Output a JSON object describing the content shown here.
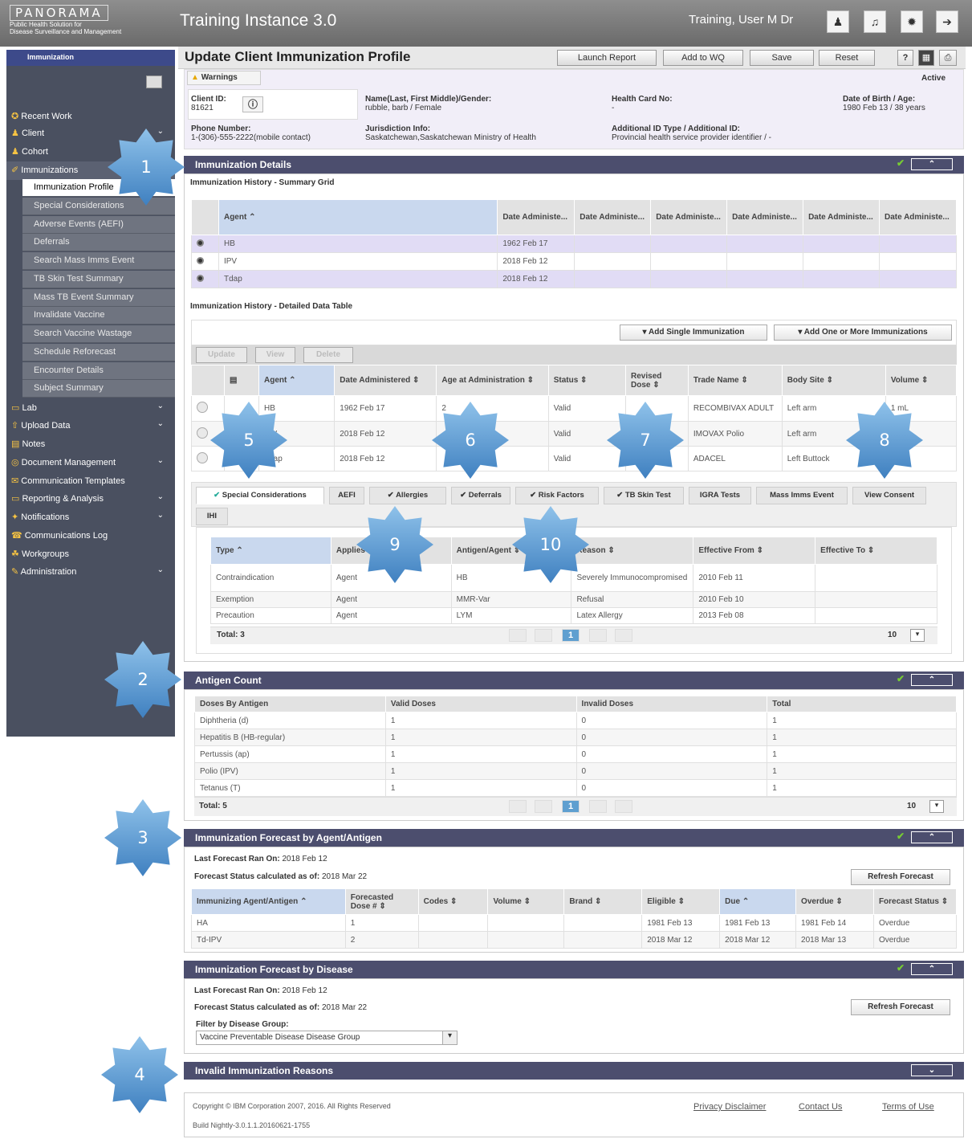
{
  "brand": {
    "name": "PANORAMA",
    "tagline1": "Public Health Solution for",
    "tagline2": "Disease Surveillance and Management"
  },
  "instance": "Training Instance 3.0",
  "user": "Training, User M Dr",
  "sidebar": {
    "header": "Immunization",
    "items": [
      {
        "label": "Recent Work",
        "icon": "✪"
      },
      {
        "label": "Client",
        "icon": "♟"
      },
      {
        "label": "Cohort",
        "icon": "♟"
      },
      {
        "label": "Immunizations",
        "icon": "✐"
      }
    ],
    "subitems": [
      "Immunization Profile",
      "Special Considerations",
      "Adverse Events (AEFI)",
      "Deferrals",
      "Search Mass Imms Event",
      "TB Skin Test Summary",
      "Mass TB Event Summary",
      "Invalidate Vaccine",
      "Search Vaccine Wastage",
      "Schedule Reforecast",
      "Encounter Details",
      "Subject Summary"
    ],
    "lower": [
      {
        "label": "Lab",
        "icon": "▭"
      },
      {
        "label": "Upload Data",
        "icon": "⇧"
      },
      {
        "label": "Notes",
        "icon": "▤"
      },
      {
        "label": "Document Management",
        "icon": "◎"
      },
      {
        "label": "Communication Templates",
        "icon": "✉"
      },
      {
        "label": "Reporting & Analysis",
        "icon": "▭"
      },
      {
        "label": "Notifications",
        "icon": "✦"
      },
      {
        "label": "Communications Log",
        "icon": "☎"
      },
      {
        "label": "Workgroups",
        "icon": "☘"
      },
      {
        "label": "Administration",
        "icon": "✎"
      }
    ]
  },
  "page": {
    "title": "Update Client Immunization Profile",
    "buttons": {
      "launch": "Launch Report",
      "wq": "Add to WQ",
      "save": "Save",
      "reset": "Reset"
    }
  },
  "client": {
    "warnings": "Warnings",
    "status": "Active",
    "id_label": "Client ID:",
    "id": "81621",
    "name_label": "Name(Last, First Middle)/Gender:",
    "name": "rubble, barb / Female",
    "hc_label": "Health Card No:",
    "hc": "-",
    "dob_label": "Date of Birth / Age:",
    "dob": "1980 Feb 13 / 38 years",
    "phone_label": "Phone Number:",
    "phone": "1-(306)-555-2222(mobile contact)",
    "juris_label": "Jurisdiction Info:",
    "juris": "Saskatchewan,Saskatchewan Ministry of Health",
    "addl_label": "Additional ID Type / Additional ID:",
    "addl": "Provincial health service provider identifier / -"
  },
  "imm": {
    "title": "Immunization Details",
    "summary_title": "Immunization History - Summary Grid",
    "summary_headers": [
      "Agent",
      "Date Administe...",
      "Date Administe...",
      "Date Administe...",
      "Date Administe...",
      "Date Administe...",
      "Date Administe..."
    ],
    "summary_rows": [
      [
        "HB",
        "1962 Feb 17"
      ],
      [
        "IPV",
        "2018 Feb 12"
      ],
      [
        "Tdap",
        "2018 Feb 12"
      ]
    ],
    "detail_title": "Immunization History - Detailed Data Table",
    "add_single": "Add Single Immunization",
    "add_more": "Add One or More Immunizations",
    "actions": [
      "Update",
      "View",
      "Delete"
    ],
    "detail_headers": [
      "Agent",
      "Date Administered",
      "Age at Administration",
      "Status",
      "Revised Dose",
      "Trade Name",
      "Body Site",
      "Volume"
    ],
    "detail_rows": [
      [
        "HB",
        "1962 Feb 17",
        "2",
        "Valid",
        "",
        "RECOMBIVAX ADULT",
        "Left arm",
        "1 mL"
      ],
      [
        "IPV",
        "2018 Feb 12",
        "",
        "Valid",
        "",
        "IMOVAX Polio",
        "Left arm",
        ""
      ],
      [
        "Tdap",
        "2018 Feb 12",
        "",
        "Valid",
        "",
        "ADACEL",
        "Left Buttock",
        ""
      ]
    ],
    "tabs": [
      "Special Considerations",
      "AEFI",
      "Allergies",
      "Deferrals",
      "Risk Factors",
      "TB Skin Test",
      "IGRA Tests",
      "Mass Imms Event",
      "View Consent",
      "IHI"
    ],
    "sc_headers": [
      "Type",
      "Applies To",
      "Antigen/Agent",
      "Reason",
      "Effective From",
      "Effective To"
    ],
    "sc_rows": [
      [
        "Contraindication",
        "Agent",
        "HB",
        "Severely Immunocompromised",
        "2010 Feb 11",
        ""
      ],
      [
        "Exemption",
        "Agent",
        "MMR-Var",
        "Refusal",
        "2010 Feb 10",
        ""
      ],
      [
        "Precaution",
        "Agent",
        "LYM",
        "Latex Allergy",
        "2013 Feb 08",
        ""
      ]
    ],
    "sc_total": "Total: 3",
    "page": "1",
    "pagesize": "10"
  },
  "antigen": {
    "title": "Antigen Count",
    "headers": [
      "Doses By Antigen",
      "Valid Doses",
      "Invalid Doses",
      "Total"
    ],
    "rows": [
      [
        "Diphtheria (d)",
        "1",
        "0",
        "1"
      ],
      [
        "Hepatitis B (HB-regular)",
        "1",
        "0",
        "1"
      ],
      [
        "Pertussis (ap)",
        "1",
        "0",
        "1"
      ],
      [
        "Polio (IPV)",
        "1",
        "0",
        "1"
      ],
      [
        "Tetanus (T)",
        "1",
        "0",
        "1"
      ]
    ],
    "total": "Total: 5",
    "page": "1",
    "pagesize": "10"
  },
  "forecast": {
    "title": "Immunization Forecast by Agent/Antigen",
    "ran_label": "Last Forecast Ran On:",
    "ran": "2018 Feb 12",
    "calc_label": "Forecast Status calculated as of:",
    "calc": "2018 Mar 22",
    "refresh": "Refresh Forecast",
    "headers": [
      "Immunizing Agent/Antigen",
      "Forecasted Dose #",
      "Codes",
      "Volume",
      "Brand",
      "Eligible",
      "Due",
      "Overdue",
      "Forecast Status"
    ],
    "rows": [
      [
        "HA",
        "1",
        "",
        "",
        "",
        "1981 Feb 13",
        "1981 Feb 13",
        "1981 Feb 14",
        "Overdue"
      ],
      [
        "Td-IPV",
        "2",
        "",
        "",
        "",
        "2018 Mar 12",
        "2018 Mar 12",
        "2018 Mar 13",
        "Overdue"
      ]
    ]
  },
  "disease": {
    "title": "Immunization Forecast by Disease",
    "ran_label": "Last Forecast Ran On:",
    "ran": "2018 Feb 12",
    "calc_label": "Forecast Status calculated as of:",
    "calc": "2018 Mar 22",
    "refresh": "Refresh Forecast",
    "filter_label": "Filter by Disease Group:",
    "filter_value": "Vaccine Preventable Disease Disease Group"
  },
  "invalid": {
    "title": "Invalid Immunization Reasons"
  },
  "footer": {
    "copyright": "Copyright © IBM Corporation 2007, 2016. All Rights Reserved",
    "build": "Build Nightly-3.0.1.1.20160621-1755",
    "privacy": "Privacy Disclaimer",
    "contact": "Contact Us",
    "terms": "Terms of Use"
  },
  "callouts": [
    "1",
    "2",
    "3",
    "4",
    "5",
    "6",
    "7",
    "8",
    "9",
    "10"
  ]
}
